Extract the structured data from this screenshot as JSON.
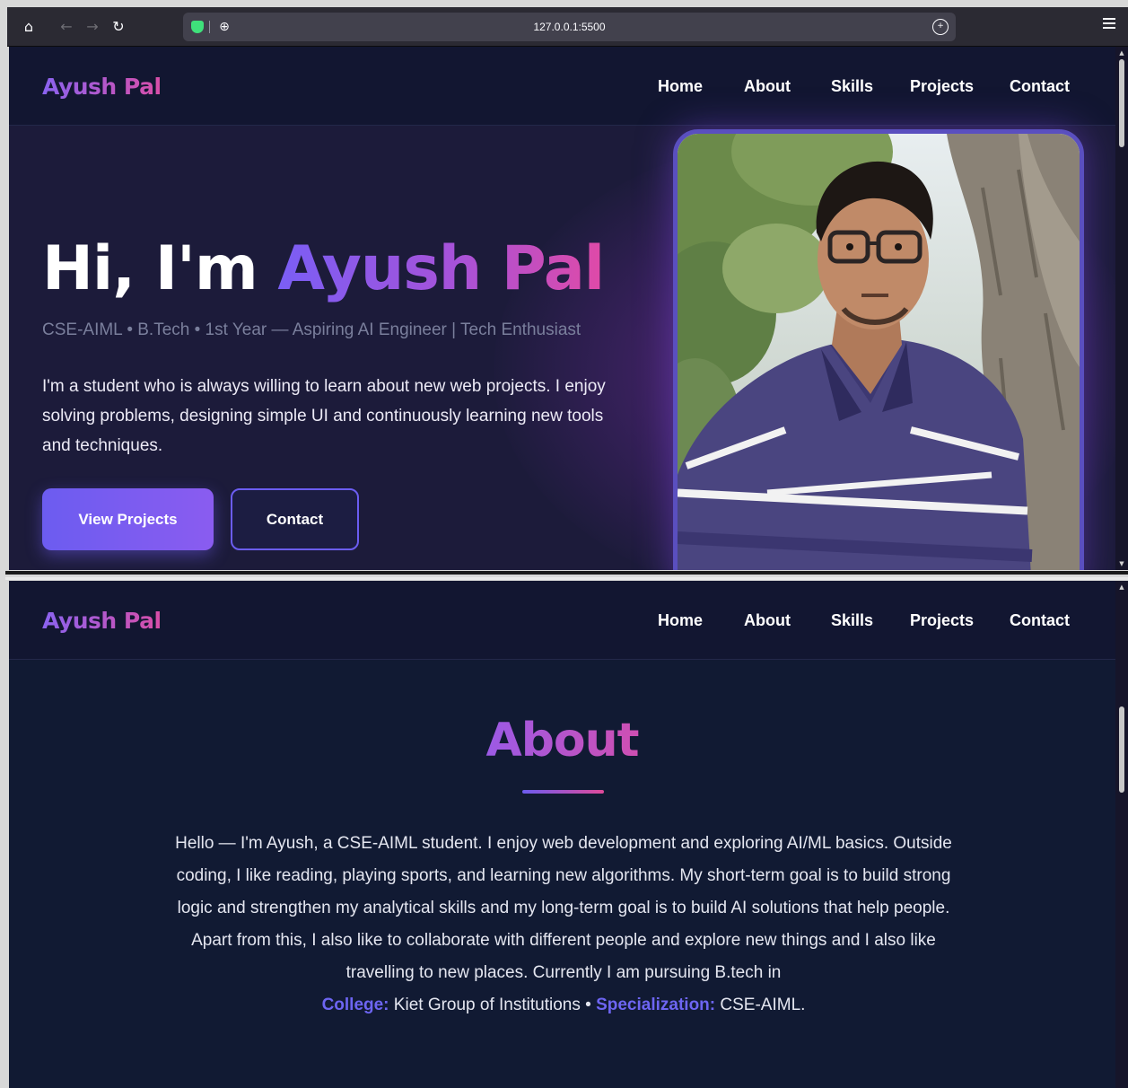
{
  "browser": {
    "url": "127.0.0.1:5500"
  },
  "site": {
    "logo": "Ayush Pal",
    "nav": [
      "Home",
      "About",
      "Skills",
      "Projects",
      "Contact"
    ]
  },
  "hero": {
    "greeting": "Hi, I'm ",
    "name": "Ayush Pal",
    "subtitle": "CSE-AIML • B.Tech • 1st Year — Aspiring AI Engineer | Tech Enthusiast",
    "description": "I'm a student who is always willing to learn about new web projects. I enjoy solving problems, designing simple UI and continuously learning new tools and techniques.",
    "primary_button": "View Projects",
    "secondary_button": "Contact"
  },
  "about": {
    "title": "About",
    "paragraph": "Hello — I'm Ayush, a CSE-AIML student. I enjoy web development and exploring AI/ML basics. Outside coding, I like reading, playing sports, and learning new algorithms. My short-term goal is to build strong logic and strengthen my analytical skills and my long-term goal is to build AI solutions that help people. Apart from this, I also like to collaborate with different people and explore new things and I also like travelling to new places. Currently I am pursuing B.tech in",
    "college_label": "College:",
    "college_value": "Kiet Group of Institutions",
    "separator": "•",
    "specialization_label": "Specialization:",
    "specialization_value": "CSE-AIML."
  },
  "colors": {
    "accent_purple": "#6c5cf0",
    "accent_pink": "#e04aa7",
    "background": "#1c1b3a"
  }
}
